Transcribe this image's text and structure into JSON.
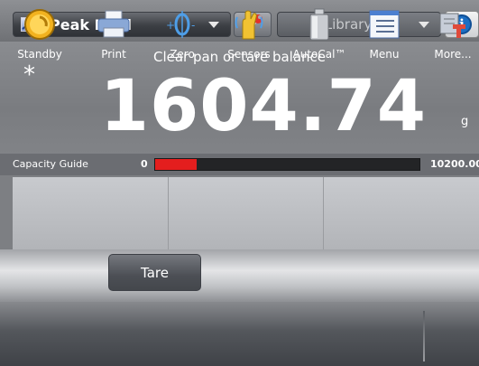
{
  "header": {
    "application": "Peak Hold",
    "library": "Library"
  },
  "display": {
    "message": "Clear pan or tare balance",
    "stable_indicator": "*",
    "weight": "1604.74",
    "unit": "g"
  },
  "capacity_guide": {
    "label": "Capacity Guide",
    "min": "0",
    "max": "10200.00",
    "fill_fraction": 0.157,
    "fill_color": "#e41e1e"
  },
  "actions": {
    "tare_label": "Tare"
  },
  "navbar": {
    "items": [
      {
        "label": "Standby",
        "icon": "standby-icon"
      },
      {
        "label": "Print",
        "icon": "printer-icon"
      },
      {
        "label": "Zero",
        "icon": "zero-icon"
      },
      {
        "label": "Sensors",
        "icon": "sensor-hand-icon"
      },
      {
        "label": "AutoCal™",
        "icon": "calibration-weight-icon"
      },
      {
        "label": "Menu",
        "icon": "menu-icon"
      },
      {
        "label": "More...",
        "icon": "more-icon"
      }
    ]
  }
}
